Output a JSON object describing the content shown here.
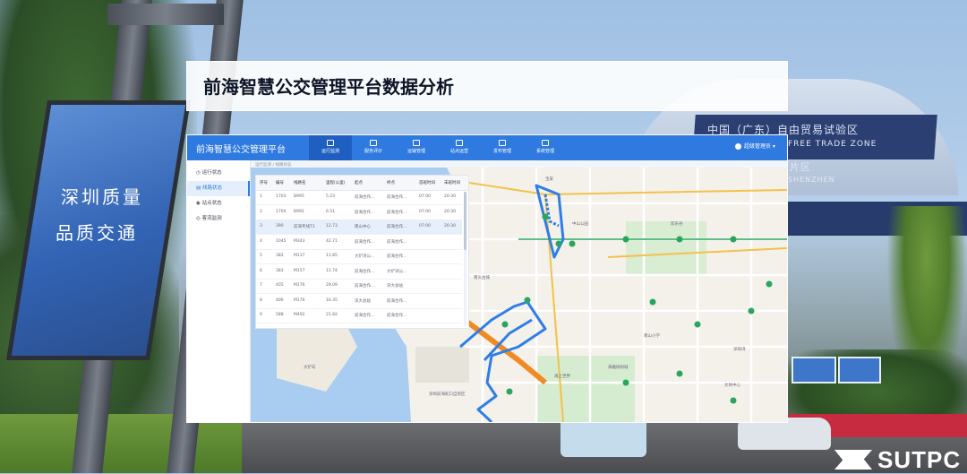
{
  "overlay_title": "前海智慧公交管理平台数据分析",
  "scene": {
    "sign_line1": "深圳质量",
    "sign_line2": "品质交通",
    "gate_line1": "中国（广东）自由贸易试验区",
    "gate_line2": "FREE TRADE ZONE",
    "gate_line3": "片区",
    "gate_line4": "SHENZHEN"
  },
  "app": {
    "title": "前海智慧公交管理平台",
    "nav": [
      "运行监测",
      "服务评价",
      "运输管理",
      "站点运营",
      "发布管理",
      "系统管理"
    ],
    "user": "超级管理员",
    "sidebar": [
      "运行状态",
      "线路状态",
      "站点状态",
      "客流监测"
    ],
    "breadcrumb": "运行监测 / 线路状态",
    "table": {
      "headers": [
        "序号",
        "编号",
        "线路名",
        "里程(公里)",
        "起点",
        "终点",
        "首班时间",
        "末班时间"
      ],
      "rows": [
        [
          "1",
          "1703",
          "B995",
          "5.23",
          "前海合作...",
          "前海合作...",
          "07:00",
          "20:30"
        ],
        [
          "2",
          "1704",
          "B992",
          "6.51",
          "前海合作...",
          "前海合作...",
          "07:00",
          "20:30"
        ],
        [
          "3",
          "390",
          "前海专线T3",
          "12.73",
          "南山中心",
          "前海合作...",
          "07:00",
          "20:30"
        ],
        [
          "4",
          "1045",
          "M343",
          "42.71",
          "前海合作...",
          "前海合作...",
          "",
          ""
        ],
        [
          "5",
          "382",
          "M137",
          "11.85",
          "大铲湾公...",
          "前海合作...",
          "",
          ""
        ],
        [
          "6",
          "383",
          "M157",
          "11.74",
          "前海合作...",
          "大铲湾公...",
          "",
          ""
        ],
        [
          "7",
          "405",
          "M176",
          "29.09",
          "前海合作...",
          "深大总站",
          "",
          ""
        ],
        [
          "8",
          "406",
          "M176",
          "16.35",
          "深大总站",
          "前海合作...",
          "",
          ""
        ],
        [
          "9",
          "588",
          "M492",
          "21.82",
          "前海合作...",
          "前海合作...",
          "",
          ""
        ]
      ]
    },
    "map_labels": [
      "大铲岛",
      "海雅缤纷城",
      "南山小学",
      "深圳湾",
      "南头古城",
      "前海湾",
      "中山公园",
      "欢乐谷",
      "宝安",
      "海上世界",
      "深圳前海蛇口自贸区",
      "文体中心"
    ]
  },
  "logo": {
    "text": "SUTPC"
  },
  "colors": {
    "header_blue": "#2e7ae0",
    "route_blue": "#2f7ee8",
    "metro_orange": "#f08a24",
    "station_green": "#28a55e",
    "water": "#a9cdf0"
  }
}
